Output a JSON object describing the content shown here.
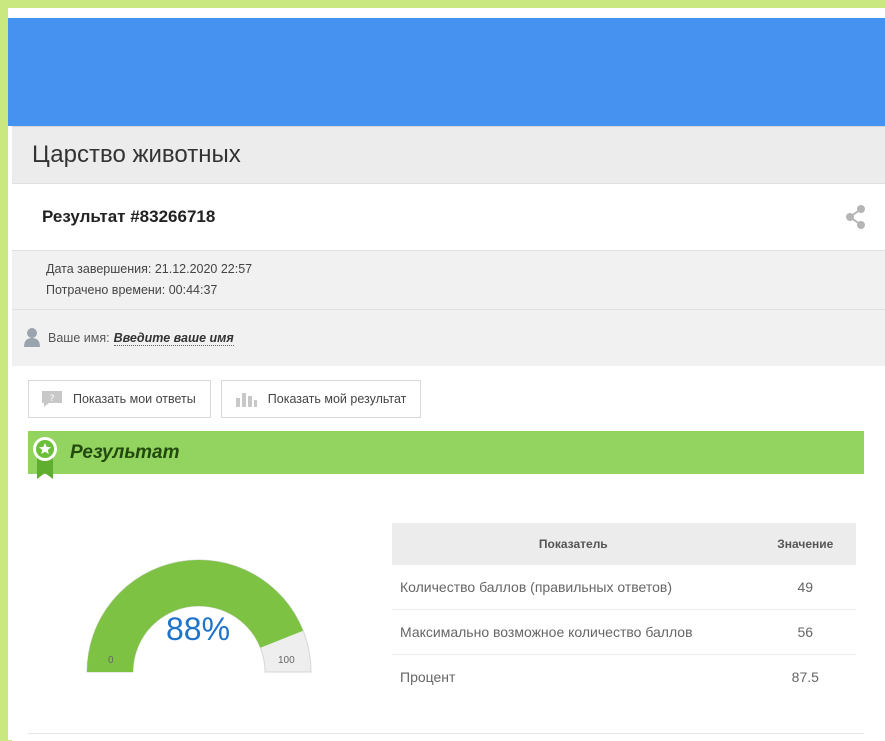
{
  "quiz": {
    "title": "Царство животных",
    "result_title": "Результат #83266718",
    "completion_date": "Дата завершения: 21.12.2020 22:57",
    "time_spent": "Потрачено времени: 00:44:37",
    "name_label": "Ваше имя:",
    "name_placeholder": "Введите ваше имя"
  },
  "buttons": {
    "show_answers": "Показать мои ответы",
    "show_result": "Показать мой результат"
  },
  "result_section": {
    "title": "Результат"
  },
  "gauge": {
    "percent_label": "88%",
    "value_fraction": 0.88,
    "min_label": "0",
    "max_label": "100",
    "fill_color": "#7dc242",
    "empty_color": "#eeeeee"
  },
  "table": {
    "headers": [
      "Показатель",
      "Значение"
    ],
    "rows": [
      {
        "label": "Количество баллов (правильных ответов)",
        "value": "49"
      },
      {
        "label": "Максимально возможное количество баллов",
        "value": "56"
      },
      {
        "label": "Процент",
        "value": "87.5"
      }
    ]
  },
  "icons": {
    "share": "share-icon",
    "user": "user-icon",
    "answers": "speech-bubble-icon",
    "result": "bar-chart-icon",
    "badge": "award-ribbon-icon"
  }
}
